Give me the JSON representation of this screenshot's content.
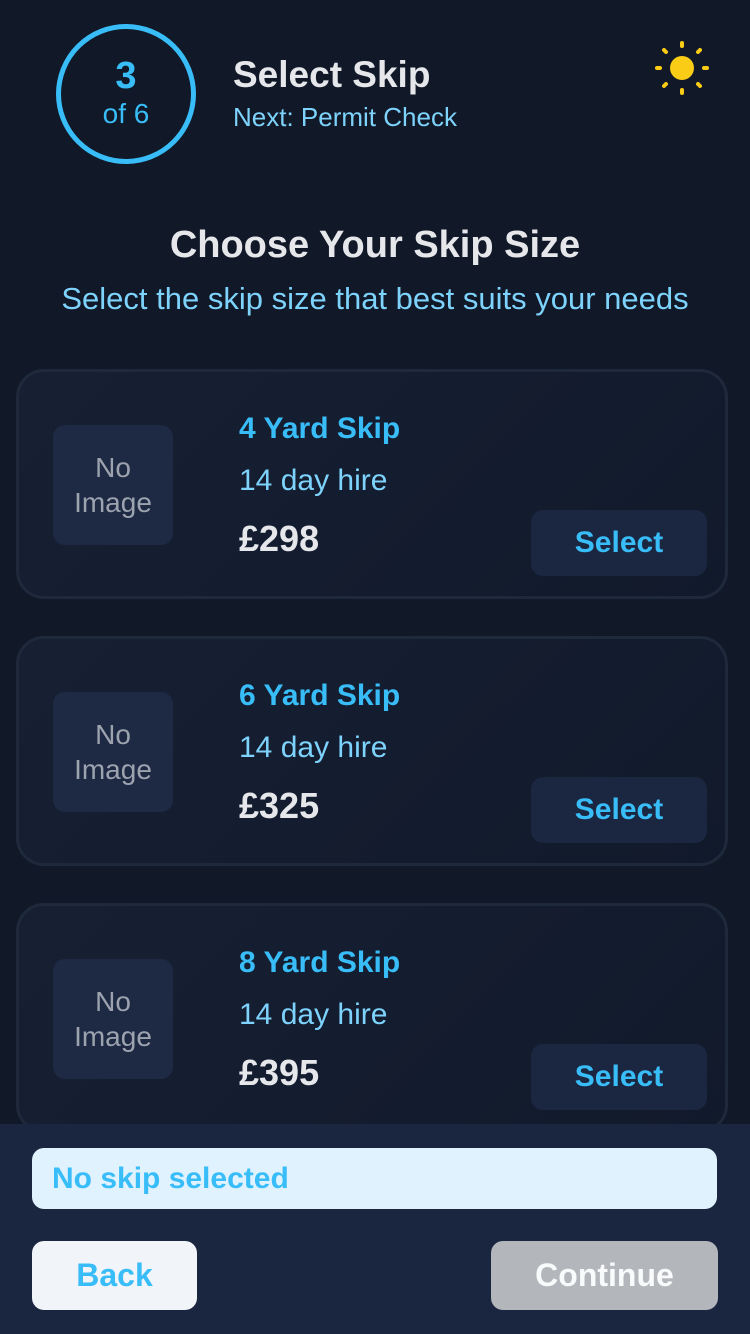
{
  "header": {
    "step_number": "3",
    "step_of": "of 6",
    "title": "Select Skip",
    "next": "Next: Permit Check",
    "theme_icon": "sun-icon",
    "accent_color": "#38bdf8",
    "sun_color": "#facc15"
  },
  "section": {
    "title": "Choose Your Skip Size",
    "subtitle": "Select the skip size that best suits your needs"
  },
  "skips": [
    {
      "image_placeholder": "No Image",
      "name": "4 Yard Skip",
      "hire": "14 day hire",
      "price": "£298",
      "button": "Select"
    },
    {
      "image_placeholder": "No Image",
      "name": "6 Yard Skip",
      "hire": "14 day hire",
      "price": "£325",
      "button": "Select"
    },
    {
      "image_placeholder": "No Image",
      "name": "8 Yard Skip",
      "hire": "14 day hire",
      "price": "£395",
      "button": "Select"
    }
  ],
  "footer": {
    "status": "No skip selected",
    "back_label": "Back",
    "continue_label": "Continue",
    "continue_disabled": true
  }
}
